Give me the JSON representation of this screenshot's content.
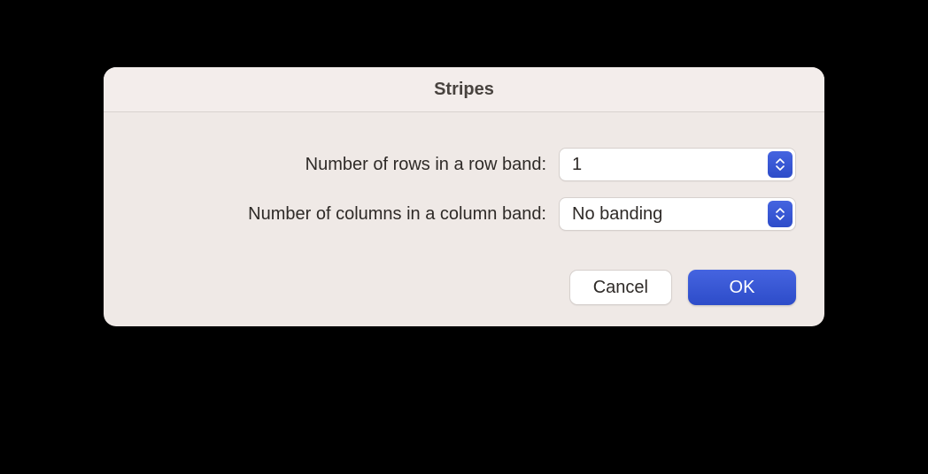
{
  "dialog": {
    "title": "Stripes",
    "rows_label": "Number of rows in a row band:",
    "rows_value": "1",
    "columns_label": "Number of columns in a column band:",
    "columns_value": "No banding",
    "cancel_label": "Cancel",
    "ok_label": "OK"
  }
}
